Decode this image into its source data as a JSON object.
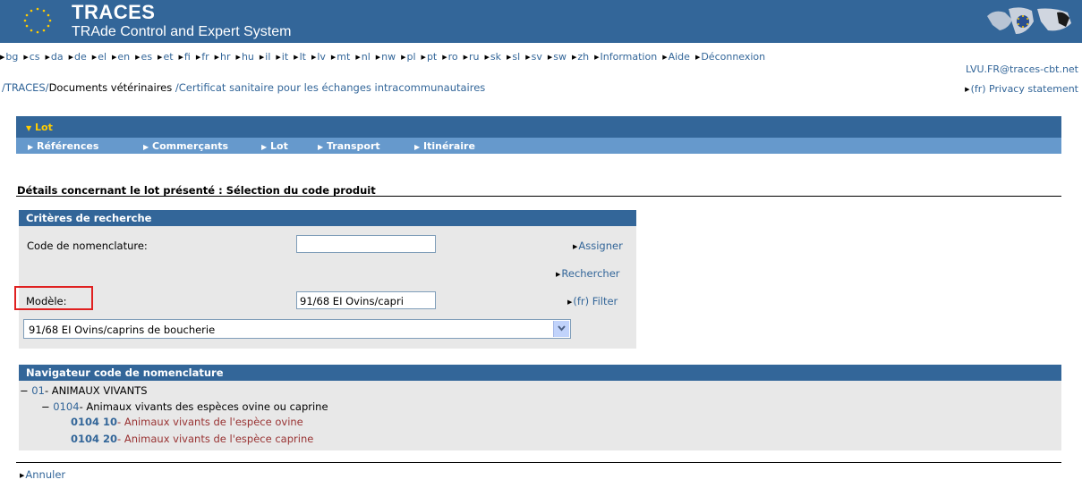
{
  "header": {
    "title": "TRACES",
    "subtitle": "TRAde Control and Expert System",
    "brand_color": "#336699"
  },
  "languages": [
    "bg",
    "cs",
    "da",
    "de",
    "el",
    "en",
    "es",
    "et",
    "fi",
    "fr",
    "hr",
    "hu",
    "il",
    "it",
    "lt",
    "lv",
    "mt",
    "nl",
    "nw",
    "pl",
    "pt",
    "ro",
    "ru",
    "sk",
    "sl",
    "sv",
    "sw",
    "zh"
  ],
  "top_links": {
    "information": "Information",
    "help": "Aide",
    "logout": "Déconnexion"
  },
  "user": "LVU.FR@traces-cbt.net",
  "breadcrumb": {
    "root": "/TRACES/",
    "section": "Documents vétérinaires",
    "sep": " /",
    "page": "Certificat sanitaire pour les échanges intracommunautaires"
  },
  "privacy": "(fr) Privacy statement",
  "tabs": {
    "active": "Lot",
    "sub": [
      "Références",
      "Commerçants",
      "Lot",
      "Transport",
      "Itinéraire"
    ]
  },
  "section_title": "Détails concernant le lot présenté : Sélection du code produit",
  "criteria": {
    "header": "Critères de recherche",
    "code_label": "Code de nomenclature:",
    "code_value": "",
    "assign": "Assigner",
    "search": "Rechercher",
    "model_label": "Modèle:",
    "model_value": "91/68 EI Ovins/capri",
    "filter": "(fr) Filter",
    "select_value": "91/68 EI Ovins/caprins de boucherie"
  },
  "navigator": {
    "header": "Navigateur code de nomenclature",
    "level1": {
      "code": "01",
      "label": "- ANIMAUX VIVANTS"
    },
    "level2": {
      "code": "0104",
      "label": "- Animaux vivants des espèces ovine ou caprine"
    },
    "leaves": [
      {
        "code": "0104 10",
        "label": "- Animaux vivants de l'espèce ovine"
      },
      {
        "code": "0104 20",
        "label": "- Animaux vivants de l'espèce caprine"
      }
    ]
  },
  "cancel": "Annuler",
  "colors": {
    "header": "#336699",
    "subbar": "#6699cc",
    "active_tab": "#ffcc00",
    "panel": "#e8e8e8",
    "highlight": "#e02020"
  }
}
